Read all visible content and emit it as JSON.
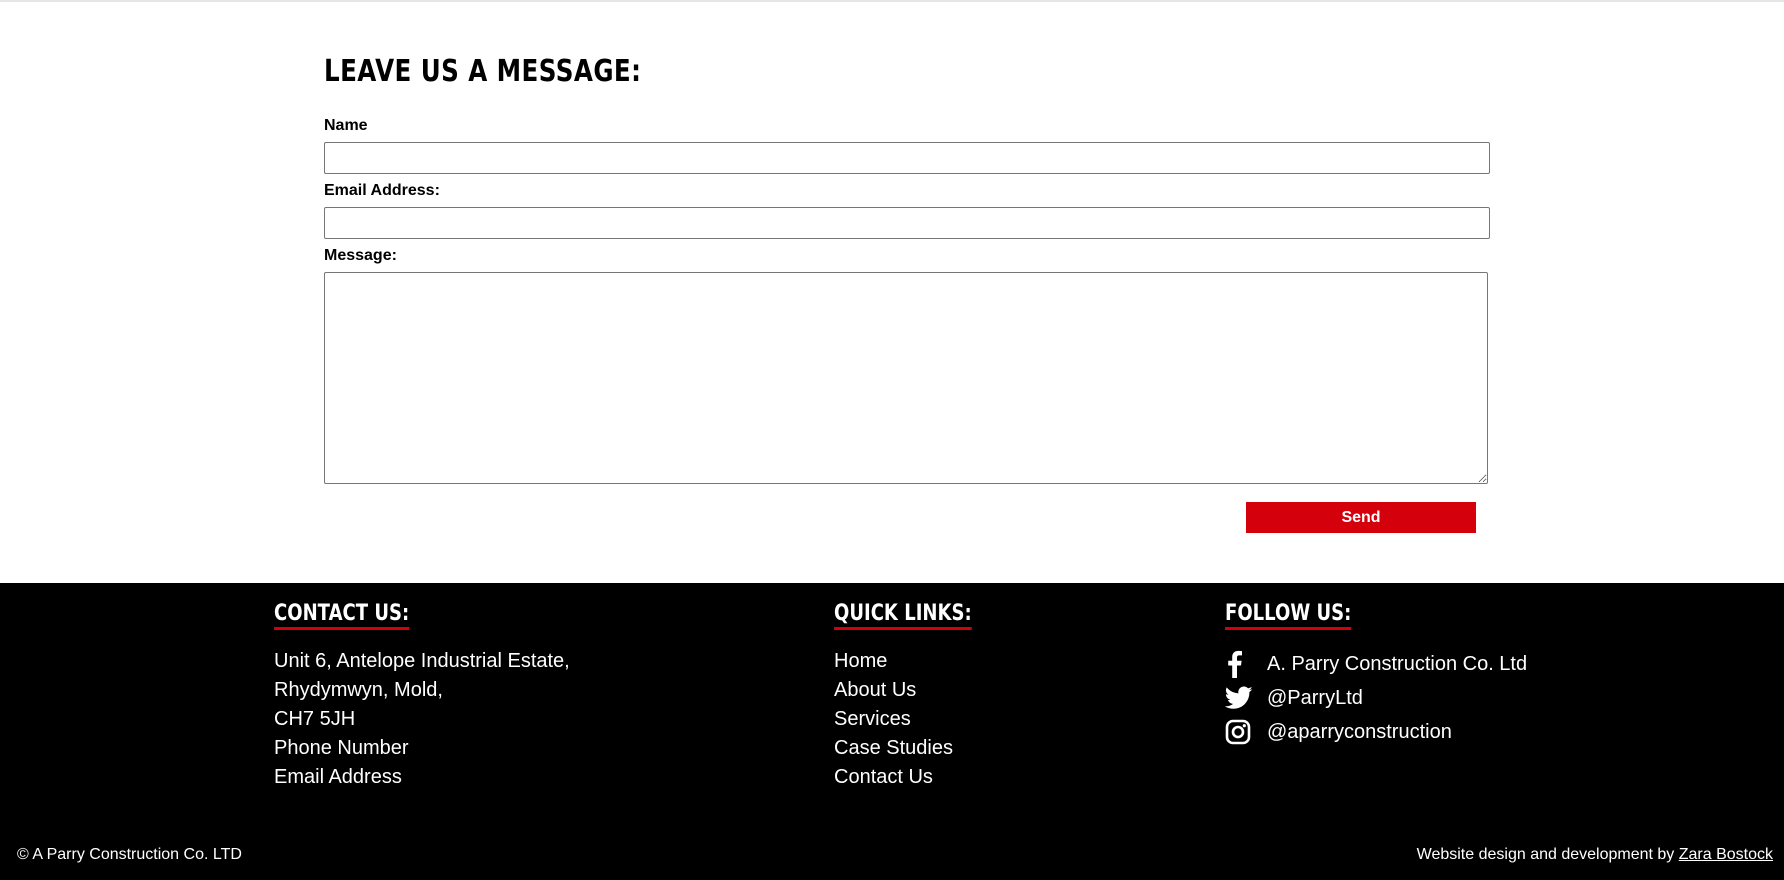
{
  "form": {
    "title": "LEAVE US A MESSAGE:",
    "name_label": "Name",
    "name_value": "",
    "email_label": "Email Address:",
    "email_value": "",
    "message_label": "Message:",
    "message_value": "",
    "send_label": "Send"
  },
  "footer": {
    "contact": {
      "heading": "CONTACT US:",
      "lines": [
        "Unit 6, Antelope Industrial Estate,",
        "Rhydymwyn, Mold,",
        "CH7 5JH",
        "Phone Number",
        "Email Address"
      ]
    },
    "quick_links": {
      "heading": "QUICK LINKS:",
      "items": [
        "Home",
        "About Us",
        "Services",
        "Case Studies",
        "Contact Us"
      ]
    },
    "follow": {
      "heading": "FOLLOW US:",
      "items": [
        {
          "icon": "facebook-icon",
          "label": "A. Parry Construction Co. Ltd"
        },
        {
          "icon": "twitter-icon",
          "label": "@ParryLtd"
        },
        {
          "icon": "instagram-icon",
          "label": "@aparryconstruction"
        }
      ]
    },
    "copyright": "© A Parry Construction Co. LTD",
    "credit_prefix": "Website design and development by ",
    "credit_link": "Zara Bostock"
  },
  "colors": {
    "accent": "#d4000c",
    "footer_bg": "#000000",
    "footer_text": "#ffffff"
  }
}
